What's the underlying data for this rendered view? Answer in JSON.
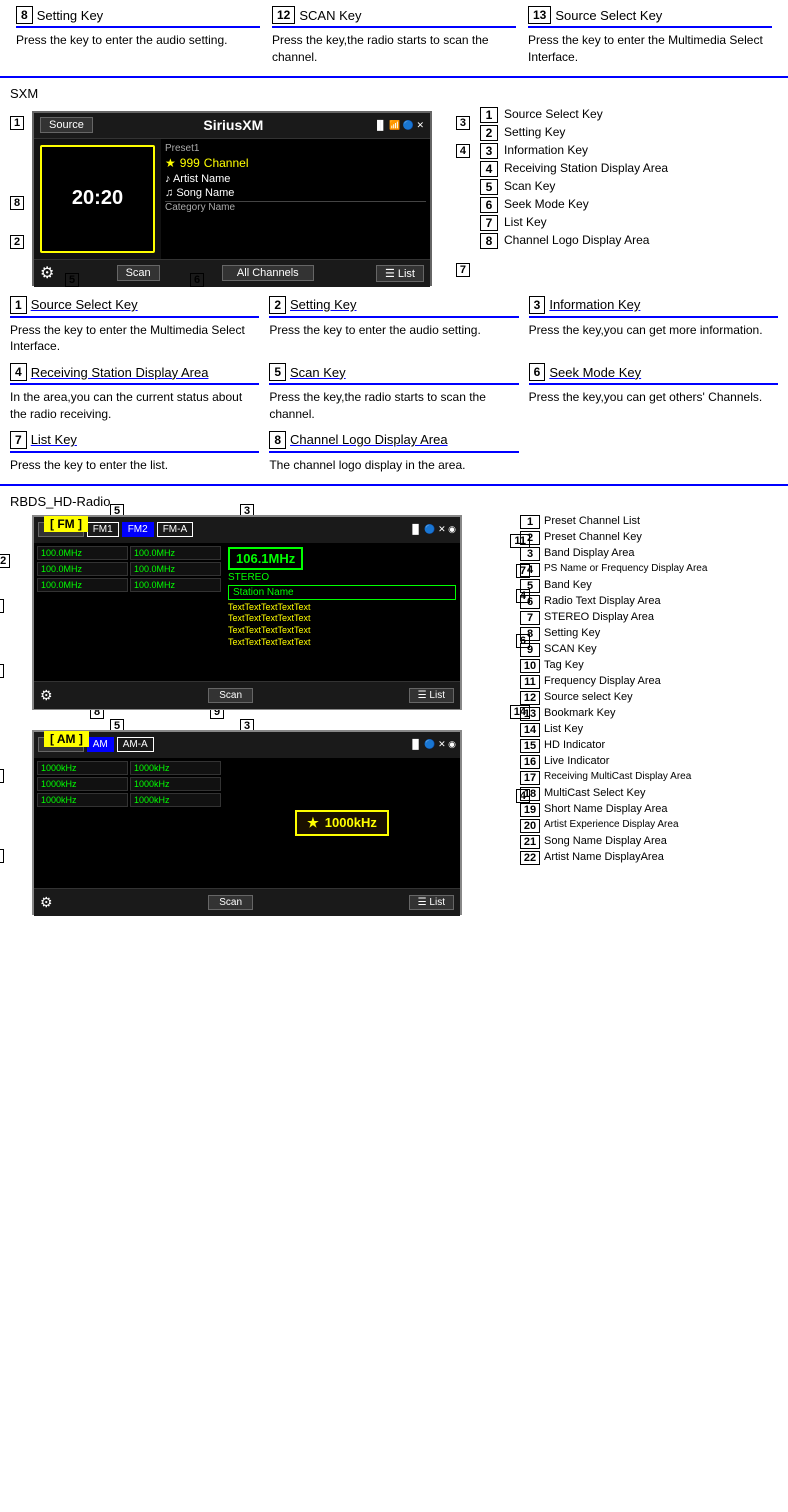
{
  "top": {
    "col1": {
      "num": "8",
      "label": "Setting Key",
      "desc": "Press the key to enter the audio setting."
    },
    "col2": {
      "num": "12",
      "label": "SCAN Key",
      "desc": "Press the key,the radio starts to scan the channel."
    },
    "col3": {
      "num": "13",
      "label": "Source Select Key",
      "desc": "Press the key to enter the Multimedia Select Interface."
    }
  },
  "sxm": {
    "label": "SXM",
    "screen": {
      "source": "Source",
      "title": "SiriusXM",
      "preset": "Preset1",
      "channel_num": "999",
      "channel_label": "Channel",
      "artist": "Artist Name",
      "song": "Song Name",
      "category": "Category Name",
      "scan": "Scan",
      "all_channels": "All Channels",
      "list": "List",
      "logo": "20:20"
    },
    "legend": [
      {
        "num": "1",
        "text": "Source Select Key"
      },
      {
        "num": "2",
        "text": "Setting Key"
      },
      {
        "num": "3",
        "text": "Information Key"
      },
      {
        "num": "4",
        "text": "Receiving Station Display Area"
      },
      {
        "num": "5",
        "text": "Scan Key"
      },
      {
        "num": "6",
        "text": "Seek Mode Key"
      },
      {
        "num": "7",
        "text": "List Key"
      },
      {
        "num": "8",
        "text": "Channel Logo Display Area"
      }
    ],
    "keys": [
      {
        "num": "1",
        "label": "Source Select Key",
        "desc": "Press the key to enter the Multimedia Select Interface."
      },
      {
        "num": "2",
        "label": "Setting Key",
        "desc": "Press the key to enter the audio setting."
      },
      {
        "num": "3",
        "label": "Information Key",
        "desc": "Press the key,you can get more information."
      },
      {
        "num": "4",
        "label": "Receiving Station Display Area",
        "desc": "In the area,you can the current status about the radio receiving."
      },
      {
        "num": "5",
        "label": "Scan Key",
        "desc": "Press the key,the radio starts to scan the channel."
      },
      {
        "num": "6",
        "label": "Seek Mode Key",
        "desc": "Press the key,you can get others' Channels."
      },
      {
        "num": "7",
        "label": "List Key",
        "desc": "Press the key to enter the list."
      },
      {
        "num": "8",
        "label": "Channel Logo Display Area",
        "desc": "The channel logo display in the area."
      }
    ]
  },
  "rbds": {
    "label": "RBDS_HD-Radio",
    "fm_screen": {
      "band_label": "[ FM ]",
      "source": "Source",
      "bands": [
        "FM1",
        "FM2",
        "FM-A"
      ],
      "freq_display": "106.1MHz",
      "stereo": "STEREO",
      "station": "Station Name",
      "text": "TextTextTextTextText\nTextTextTextTextText\nTextTextTextTextText\nTextTextTextTextText",
      "presets": [
        [
          "100.0MHz",
          "100.0MHz"
        ],
        [
          "100.0MHz",
          "100.0MHz"
        ],
        [
          "100.0MHz",
          "100.0MHz"
        ]
      ],
      "scan": "Scan",
      "list": "List"
    },
    "am_screen": {
      "band_label": "[ AM ]",
      "source": "Source",
      "bands": [
        "AM",
        "AM-A"
      ],
      "freq_selected": "1000kHz",
      "presets": [
        [
          "1000kHz",
          "1000kHz"
        ],
        [
          "1000kHz",
          "1000kHz"
        ],
        [
          "1000kHz",
          "1000kHz"
        ]
      ],
      "scan": "Scan",
      "list": "List"
    },
    "legend": [
      {
        "num": "1",
        "text": "Preset Channel List"
      },
      {
        "num": "2",
        "text": "Preset Channel Key"
      },
      {
        "num": "3",
        "text": "Band Display Area"
      },
      {
        "num": "4",
        "text": "PS Name or Frequency Display Area"
      },
      {
        "num": "5",
        "text": "Band Key"
      },
      {
        "num": "6",
        "text": "Radio Text Display Area"
      },
      {
        "num": "7",
        "text": "STEREO Display Area"
      },
      {
        "num": "8",
        "text": "Setting Key"
      },
      {
        "num": "9",
        "text": "SCAN Key"
      },
      {
        "num": "10",
        "text": "Tag Key"
      },
      {
        "num": "11",
        "text": "Frequency Display Area"
      },
      {
        "num": "12",
        "text": "Source select Key"
      },
      {
        "num": "13",
        "text": "Bookmark Key"
      },
      {
        "num": "14",
        "text": "List Key"
      },
      {
        "num": "15",
        "text": "HD Indicator"
      },
      {
        "num": "16",
        "text": "Live Indicator"
      },
      {
        "num": "17",
        "text": "Receiving MultiCast Display Area"
      },
      {
        "num": "18",
        "text": "MultiCast Select Key"
      },
      {
        "num": "19",
        "text": "Short Name Display Area"
      },
      {
        "num": "20",
        "text": "Artist Experience Display Area"
      },
      {
        "num": "21",
        "text": "Song Name Display Area"
      },
      {
        "num": "22",
        "text": "Artist Name DisplayArea"
      }
    ]
  }
}
